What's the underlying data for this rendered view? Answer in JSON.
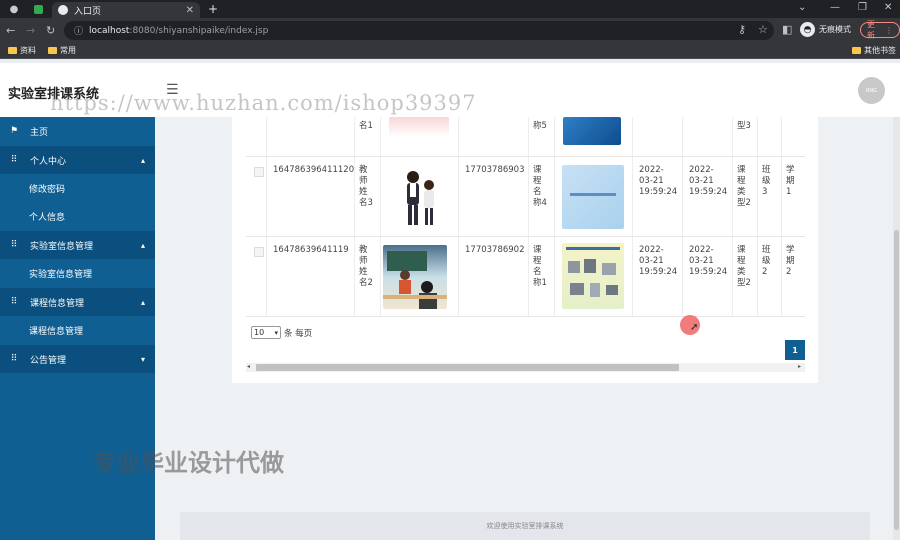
{
  "browser": {
    "tab_title": "入口页",
    "url_host": "localhost",
    "url_path": ":8080/shiyanshipaike/index.jsp",
    "incognito_label": "无痕模式",
    "update_label": "更新",
    "bookmarks": [
      "资料",
      "常用"
    ],
    "other_bookmarks": "其他书签"
  },
  "header": {
    "app_title": "实验室排课系统",
    "watermark_url": "https://www.huzhan.com/ishop39397",
    "avatar_text": "RNG"
  },
  "sidebar": {
    "items": [
      {
        "label": "主页",
        "type": "top",
        "icon": "flag-icon"
      },
      {
        "label": "个人中心",
        "type": "group",
        "icon": "grid-icon"
      },
      {
        "label": "修改密码",
        "type": "sub"
      },
      {
        "label": "个人信息",
        "type": "sub"
      },
      {
        "label": "实验室信息管理",
        "type": "group",
        "icon": "grid-icon"
      },
      {
        "label": "实验室信息管理",
        "type": "sub"
      },
      {
        "label": "课程信息管理",
        "type": "group",
        "icon": "grid-icon"
      },
      {
        "label": "课程信息管理",
        "type": "sub"
      },
      {
        "label": "公告管理",
        "type": "group",
        "icon": "grid-icon"
      }
    ]
  },
  "table": {
    "partial_row": {
      "teacher_name": "名1",
      "course_name": "称5",
      "course_type": "型3"
    },
    "rows": [
      {
        "id": "164786396411120",
        "teacher_name": "教师姓名3",
        "phone": "17703786903",
        "course_name": "课程名称4",
        "start_time": "2022-03-21 19:59:24",
        "end_time": "2022-03-21 19:59:24",
        "course_type": "课程类型2",
        "class": "班级3",
        "term": "学期1"
      },
      {
        "id": "16478639641119",
        "teacher_name": "教师姓名2",
        "phone": "17703786902",
        "course_name": "课程名称1",
        "start_time": "2022-03-21 19:59:24",
        "end_time": "2022-03-21 19:59:24",
        "course_type": "课程类型2",
        "class": "班级2",
        "term": "学期2"
      }
    ]
  },
  "pager": {
    "page_size": "10",
    "per_page_label": "条 每页",
    "current_page": "1"
  },
  "overlay_text": "专业毕业设计代做",
  "footer_text": "欢迎使用实验室排课系统"
}
